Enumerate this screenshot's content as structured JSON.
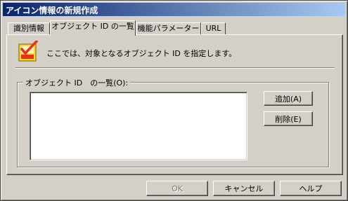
{
  "window": {
    "title": "アイコン情報の新規作成"
  },
  "tabs": [
    {
      "label": "識別情報"
    },
    {
      "label": "オブジェクト ID の一覧"
    },
    {
      "label": "機能パラメーター"
    },
    {
      "label": "URL"
    }
  ],
  "active_tab": "オブジェクト ID の一覧",
  "panel": {
    "description": "ここでは、対象となるオブジェクト ID を指定します。",
    "group_label": "オブジェクト ID　の一覧(O):",
    "add_button": "追加(A)",
    "delete_button": "削除(E)",
    "list_items": []
  },
  "footer": {
    "ok_button": "OK",
    "cancel_button": "キャンセル",
    "help_button": "ヘルプ"
  },
  "icons": {
    "app_icon": "checklist-icon"
  },
  "colors": {
    "titlebar_start": "#0a246a",
    "titlebar_end": "#a6caf0",
    "face": "#d4d0c8",
    "icon_red": "#e8301c",
    "icon_yellow": "#f8d830"
  }
}
